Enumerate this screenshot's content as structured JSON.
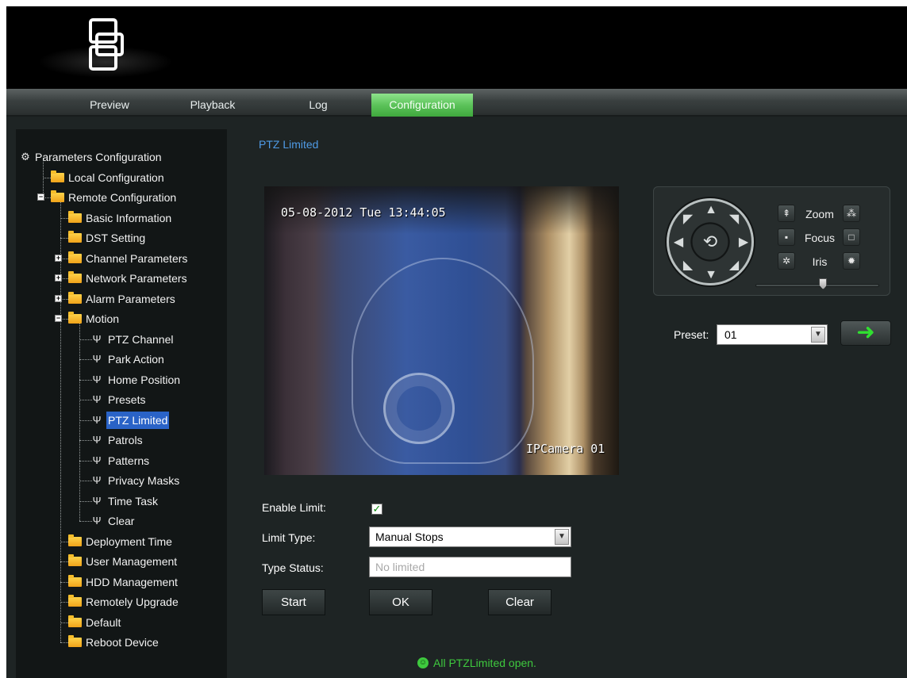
{
  "nav": {
    "tabs": [
      {
        "label": "Preview"
      },
      {
        "label": "Playback"
      },
      {
        "label": "Log"
      },
      {
        "label": "Configuration",
        "active": true
      }
    ]
  },
  "tree": {
    "root": "Parameters Configuration",
    "local": "Local Configuration",
    "remote": "Remote Configuration",
    "remote_children": [
      "Basic Information",
      "DST Setting",
      "Channel Parameters",
      "Network Parameters",
      "Alarm Parameters",
      "Motion"
    ],
    "motion_children": [
      "PTZ Channel",
      "Park Action",
      "Home Position",
      "Presets",
      "PTZ Limited",
      "Patrols",
      "Patterns",
      "Privacy Masks",
      "Time Task",
      "Clear"
    ],
    "remote_tail": [
      "Deployment Time",
      "User Management",
      "HDD Management",
      "Remotely Upgrade",
      "Default",
      "Reboot Device"
    ],
    "selected": "PTZ Limited"
  },
  "page": {
    "section_title": "PTZ Limited"
  },
  "video": {
    "timestamp": "05-08-2012 Tue 13:44:05",
    "camera_name": "IPCamera 01"
  },
  "ptz": {
    "zoom_label": "Zoom",
    "focus_label": "Focus",
    "iris_label": "Iris",
    "speed_level": 0.55,
    "icons": [
      "ptz-direction-wheel",
      "zoom-in-icon",
      "zoom-out-icon",
      "focus-near-icon",
      "focus-far-icon",
      "iris-open-icon",
      "iris-close-icon"
    ]
  },
  "preset": {
    "label": "Preset:",
    "value": "01",
    "go_icon": "right-arrow-icon"
  },
  "form": {
    "enable_limit_label": "Enable Limit:",
    "enable_limit_checked": true,
    "limit_type_label": "Limit Type:",
    "limit_type_value": "Manual Stops",
    "type_status_label": "Type Status:",
    "type_status_value": "No limited"
  },
  "buttons": {
    "start": "Start",
    "ok": "OK",
    "clear": "Clear"
  },
  "status": {
    "message": "All PTZLimited open.",
    "color": "#3ec93e"
  },
  "colors": {
    "accent_active_tab": "#5cc35a",
    "section_title": "#4f9be6",
    "selection": "#2a63c7"
  }
}
